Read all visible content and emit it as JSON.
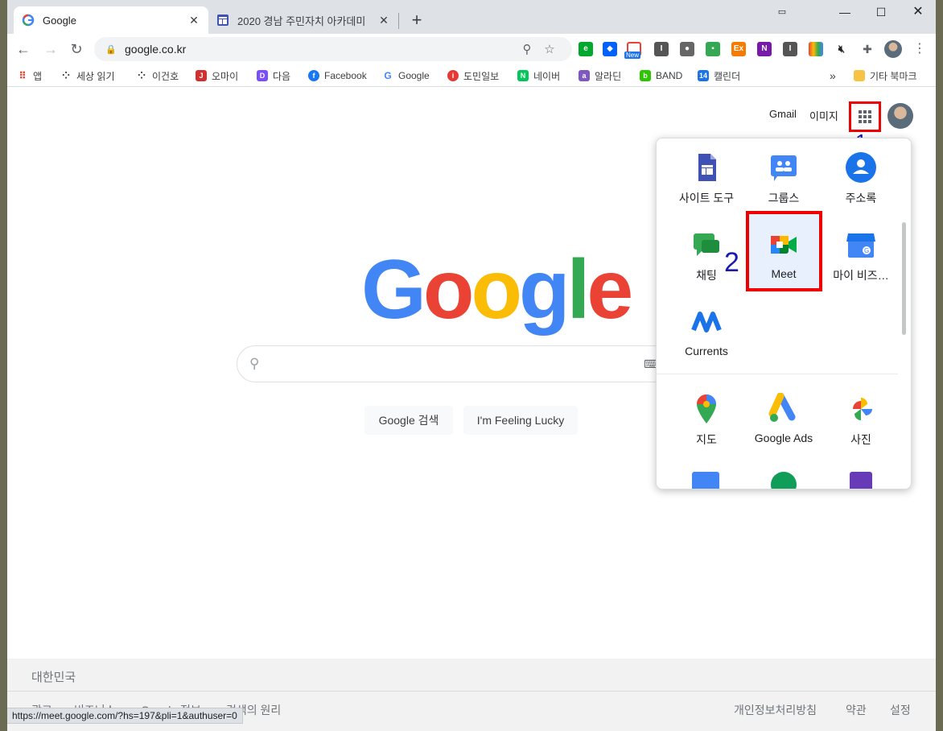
{
  "tabs": [
    {
      "title": "Google",
      "active": true
    },
    {
      "title": "2020 경남 주민자치 아카데미",
      "active": false
    }
  ],
  "toolbar": {
    "url": "google.co.kr",
    "extensions": [
      "evernote-icon",
      "dropbox-icon",
      "new-badge-icon",
      "i-icon",
      "ghost-icon",
      "green-icon",
      "ex-icon",
      "onenote-icon",
      "i2-icon",
      "color-icon",
      "mute-icon",
      "puzzle-icon",
      "profile-icon"
    ],
    "new_badge": "New"
  },
  "bookmarks": [
    {
      "label": "앱",
      "color": "#ea4335"
    },
    {
      "label": "세상 읽기",
      "color": "#333333"
    },
    {
      "label": "이건호",
      "color": "#333333"
    },
    {
      "label": "오마이",
      "color": "#d32f2f"
    },
    {
      "label": "다음",
      "color": "#7c4dff"
    },
    {
      "label": "Facebook",
      "color": "#1877f2"
    },
    {
      "label": "Google",
      "color": "#4285f4"
    },
    {
      "label": "도민일보",
      "color": "#e53935"
    },
    {
      "label": "네이버",
      "color": "#03c75a"
    },
    {
      "label": "알라딘",
      "color": "#7e57c2"
    },
    {
      "label": "BAND",
      "color": "#2dc400"
    },
    {
      "label": "캘린더",
      "color": "#1a73e8"
    }
  ],
  "bookmarks_more": "»",
  "other_bookmarks": "기타 북마크",
  "header": {
    "gmail": "Gmail",
    "images": "이미지"
  },
  "annotations": {
    "one": "1",
    "two": "2"
  },
  "search": {
    "google_search": "Google 검색",
    "lucky": "I'm Feeling Lucky"
  },
  "apps": [
    {
      "label": "사이트 도구",
      "icon": "sites-icon"
    },
    {
      "label": "그룹스",
      "icon": "groups-icon"
    },
    {
      "label": "주소록",
      "icon": "contacts-icon"
    },
    {
      "label": "채팅",
      "icon": "chat-icon"
    },
    {
      "label": "Meet",
      "icon": "meet-icon"
    },
    {
      "label": "마이 비즈…",
      "icon": "business-icon"
    },
    {
      "label": "Currents",
      "icon": "currents-icon"
    },
    {
      "label": "지도",
      "icon": "maps-icon"
    },
    {
      "label": "Google Ads",
      "icon": "ads-icon"
    },
    {
      "label": "사진",
      "icon": "photos-icon"
    }
  ],
  "footer": {
    "country": "대한민국",
    "left_links": [
      "광고",
      "비즈니스",
      "Google 정보",
      "검색의 원리"
    ],
    "right_links": [
      "개인정보처리방침",
      "약관",
      "설정"
    ]
  },
  "status_url": "https://meet.google.com/?hs=197&pli=1&authuser=0"
}
